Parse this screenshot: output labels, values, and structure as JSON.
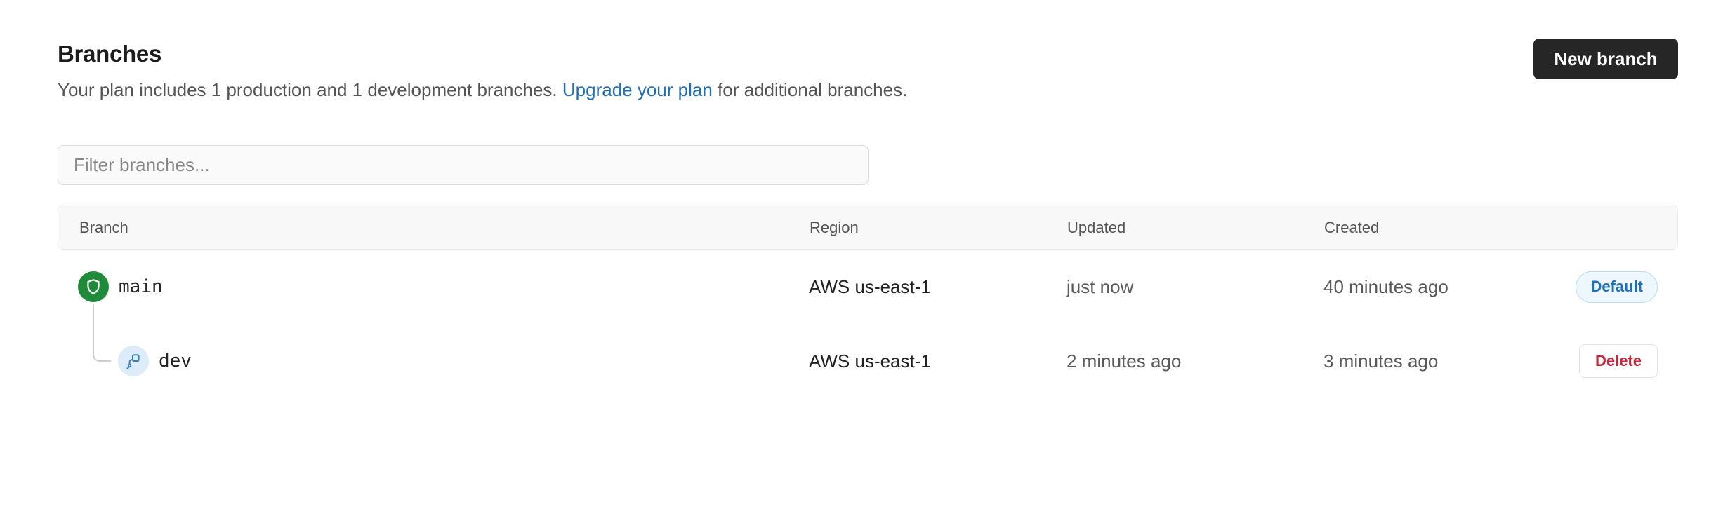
{
  "header": {
    "title": "Branches",
    "subtitle_before": "Your plan includes 1 production and 1 development branches.",
    "upgrade_link": "Upgrade your plan",
    "subtitle_after": "for additional branches.",
    "new_branch_label": "New branch"
  },
  "filter": {
    "placeholder": "Filter branches..."
  },
  "table": {
    "columns": [
      "Branch",
      "Region",
      "Updated",
      "Created"
    ],
    "rows": [
      {
        "name": "main",
        "icon": "shield-icon",
        "region": "AWS us-east-1",
        "updated": "just now",
        "created": "40 minutes ago",
        "action": "Default"
      },
      {
        "name": "dev",
        "icon": "branch-icon",
        "region": "AWS us-east-1",
        "updated": "2 minutes ago",
        "created": "3 minutes ago",
        "action": "Delete"
      }
    ]
  },
  "colors": {
    "primary_button": "#262626",
    "link": "#1e6fb8",
    "production_icon": "#1f8a3a",
    "delete": "#c8243a"
  }
}
